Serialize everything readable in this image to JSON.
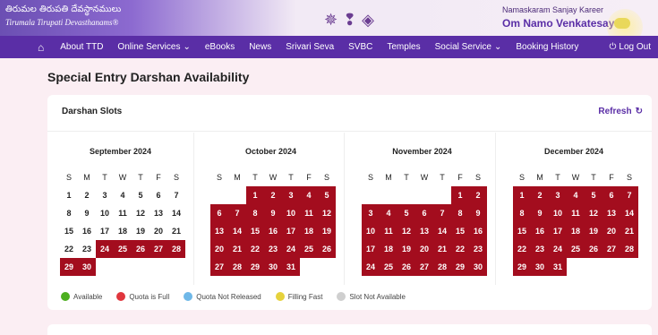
{
  "header": {
    "brand_telugu": "తిరుమల తిరుపతి దేవస్థానములు",
    "brand_english": "Tirumala Tirupati Devasthanams®",
    "greeting": "Namaskaram Sanjay Kareer",
    "tagline": "Om Namo Venkatesaya"
  },
  "nav": {
    "items": [
      "About TTD",
      "Online Services",
      "eBooks",
      "News",
      "Srivari Seva",
      "SVBC",
      "Temples",
      "Social Service",
      "Booking History"
    ],
    "logout": "Log Out"
  },
  "page": {
    "title": "Special Entry Darshan Availability"
  },
  "card": {
    "title": "Darshan Slots",
    "refresh": "Refresh"
  },
  "weekdays": [
    "S",
    "M",
    "T",
    "W",
    "T",
    "F",
    "S"
  ],
  "months": [
    {
      "name": "September 2024",
      "offset": 0,
      "days": 30,
      "quota_full": [
        24,
        25,
        26,
        27,
        28,
        29,
        30
      ]
    },
    {
      "name": "October 2024",
      "offset": 2,
      "days": 31,
      "quota_full": [
        1,
        2,
        3,
        4,
        5,
        6,
        7,
        8,
        9,
        10,
        11,
        12,
        13,
        14,
        15,
        16,
        17,
        18,
        19,
        20,
        21,
        22,
        23,
        24,
        25,
        26,
        27,
        28,
        29,
        30,
        31
      ]
    },
    {
      "name": "November 2024",
      "offset": 5,
      "days": 30,
      "quota_full": [
        1,
        2,
        3,
        4,
        5,
        6,
        7,
        8,
        9,
        10,
        11,
        12,
        13,
        14,
        15,
        16,
        17,
        18,
        19,
        20,
        21,
        22,
        23,
        24,
        25,
        26,
        27,
        28,
        29,
        30
      ]
    },
    {
      "name": "December 2024",
      "offset": 0,
      "days": 31,
      "quota_full": [
        1,
        2,
        3,
        4,
        5,
        6,
        7,
        8,
        9,
        10,
        11,
        12,
        13,
        14,
        15,
        16,
        17,
        18,
        19,
        20,
        21,
        22,
        23,
        24,
        25,
        26,
        27,
        28,
        29,
        30,
        31
      ]
    }
  ],
  "legend": [
    {
      "label": "Available",
      "color": "#4caf1f"
    },
    {
      "label": "Quota is Full",
      "color": "#e0363d"
    },
    {
      "label": "Quota Not Released",
      "color": "#6fb8e8"
    },
    {
      "label": "Filling Fast",
      "color": "#e6d23c"
    },
    {
      "label": "Slot Not Available",
      "color": "#cfcfcf"
    }
  ]
}
